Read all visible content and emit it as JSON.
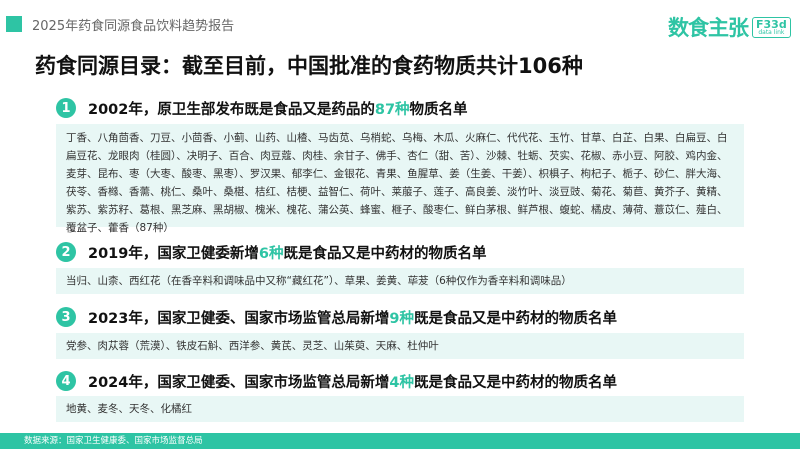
{
  "header": {
    "report_title": "2025年药食同源食品饮料趋势报告",
    "logo_text": "数食主张",
    "logo_badge_top": "F33d",
    "logo_badge_bottom": "data link"
  },
  "main_title": "药食同源目录：截至目前，中国批准的食药物质共计106种",
  "sections": [
    {
      "number": "1",
      "title_before": "2002年，原卫生部发布既是食品又是药品的",
      "title_highlight": "87种",
      "title_after": "物质名单",
      "content": "丁香、八角茴香、刀豆、小茴香、小蓟、山药、山楂、马齿苋、乌梢蛇、乌梅、木瓜、火麻仁、代代花、玉竹、甘草、白芷、白果、白扁豆、白扁豆花、龙眼肉（桂圆）、决明子、百合、肉豆蔻、肉桂、余甘子、佛手、杏仁（甜、苦）、沙棘、牡蛎、芡实、花椒、赤小豆、阿胶、鸡内金、麦芽、昆布、枣（大枣、酸枣、黑枣）、罗汉果、郁李仁、金银花、青果、鱼腥草、姜（生姜、干姜）、枳椇子、枸杞子、栀子、砂仁、胖大海、茯苓、香橼、香薷、桃仁、桑叶、桑椹、桔红、桔梗、益智仁、荷叶、莱菔子、莲子、高良姜、淡竹叶、淡豆豉、菊花、菊苣、黄芥子、黄精、紫苏、紫苏籽、葛根、黑芝麻、黑胡椒、槐米、槐花、蒲公英、蜂蜜、榧子、酸枣仁、鲜白茅根、鲜芦根、蝮蛇、橘皮、薄荷、薏苡仁、薤白、覆盆子、藿香（87种）"
    },
    {
      "number": "2",
      "title_before": "2019年，国家卫健委新增",
      "title_highlight": "6种",
      "title_after": "既是食品又是中药材的物质名单",
      "content": "当归、山柰、西红花（在香辛料和调味品中又称“藏红花”）、草果、姜黄、荜茇（6种仅作为香辛料和调味品）"
    },
    {
      "number": "3",
      "title_before": "2023年，国家卫健委、国家市场监管总局新增",
      "title_highlight": "9种",
      "title_after": "既是食品又是中药材的物质名单",
      "content": "党参、肉苁蓉（荒漠）、铁皮石斛、西洋参、黄芪、灵芝、山茱萸、天麻、杜仲叶"
    },
    {
      "number": "4",
      "title_before": "2024年，国家卫健委、国家市场监管总局新增",
      "title_highlight": "4种",
      "title_after": "既是食品又是中药材的物质名单",
      "content": "地黄、麦冬、天冬、化橘红"
    }
  ],
  "footer": {
    "source": "数据来源：国家卫生健康委、国家市场监督总局"
  },
  "colors": {
    "accent": "#2ec4a4",
    "box_background": "#e8f7f5"
  }
}
